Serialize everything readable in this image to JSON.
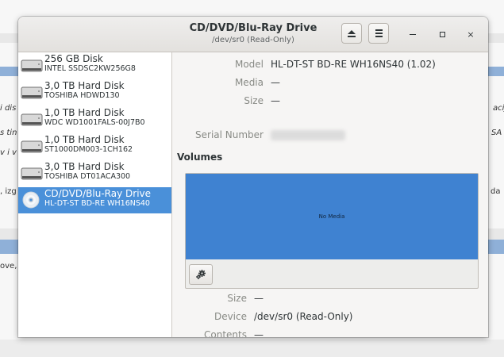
{
  "background": {
    "fragments": [
      {
        "text": "i dis",
        "side": "left"
      },
      {
        "text": "s tin",
        "side": "left"
      },
      {
        "text": "v i v",
        "side": "left"
      },
      {
        "text": ", izg",
        "side": "left"
      },
      {
        "text": "ove,",
        "side": "left"
      },
      {
        "text": "acij",
        "side": "right"
      },
      {
        "text": "SA",
        "side": "right"
      },
      {
        "text": "da",
        "side": "right"
      }
    ]
  },
  "window": {
    "title": "CD/DVD/Blu-Ray Drive",
    "subtitle": "/dev/sr0 (Read-Only)",
    "controls": {
      "minimize_icon": "minimize-icon",
      "maximize_icon": "maximize-icon",
      "close_glyph": "×"
    }
  },
  "drives": [
    {
      "name": "256 GB Disk",
      "model": "INTEL SSDSC2KW256G8",
      "icon": "hard-disk-icon",
      "selected": false
    },
    {
      "name": "3,0 TB Hard Disk",
      "model": "TOSHIBA HDWD130",
      "icon": "hard-disk-icon",
      "selected": false
    },
    {
      "name": "1,0 TB Hard Disk",
      "model": "WDC WD1001FALS-00J7B0",
      "icon": "hard-disk-icon",
      "selected": false
    },
    {
      "name": "1,0 TB Hard Disk",
      "model": "ST1000DM003-1CH162",
      "icon": "hard-disk-icon",
      "selected": false
    },
    {
      "name": "3,0 TB Hard Disk",
      "model": "TOSHIBA DT01ACA300",
      "icon": "hard-disk-icon",
      "selected": false
    },
    {
      "name": "CD/DVD/Blu-Ray Drive",
      "model": "HL-DT-ST BD-RE  WH16NS40",
      "icon": "optical-disc-icon",
      "selected": true
    }
  ],
  "drive_info": {
    "model_label": "Model",
    "model_value": "HL-DT-ST BD-RE  WH16NS40 (1.02)",
    "media_label": "Media",
    "media_value": "—",
    "size_label": "Size",
    "size_value": "—",
    "serial_label": "Serial Number"
  },
  "volumes": {
    "heading": "Volumes",
    "empty_text": "No Media",
    "size_label": "Size",
    "size_value": "—",
    "device_label": "Device",
    "device_value": "/dev/sr0 (Read-Only)",
    "contents_label": "Contents",
    "contents_value": "—"
  },
  "colors": {
    "selection": "#4a90d9",
    "volume_map": "#3f82d1"
  }
}
